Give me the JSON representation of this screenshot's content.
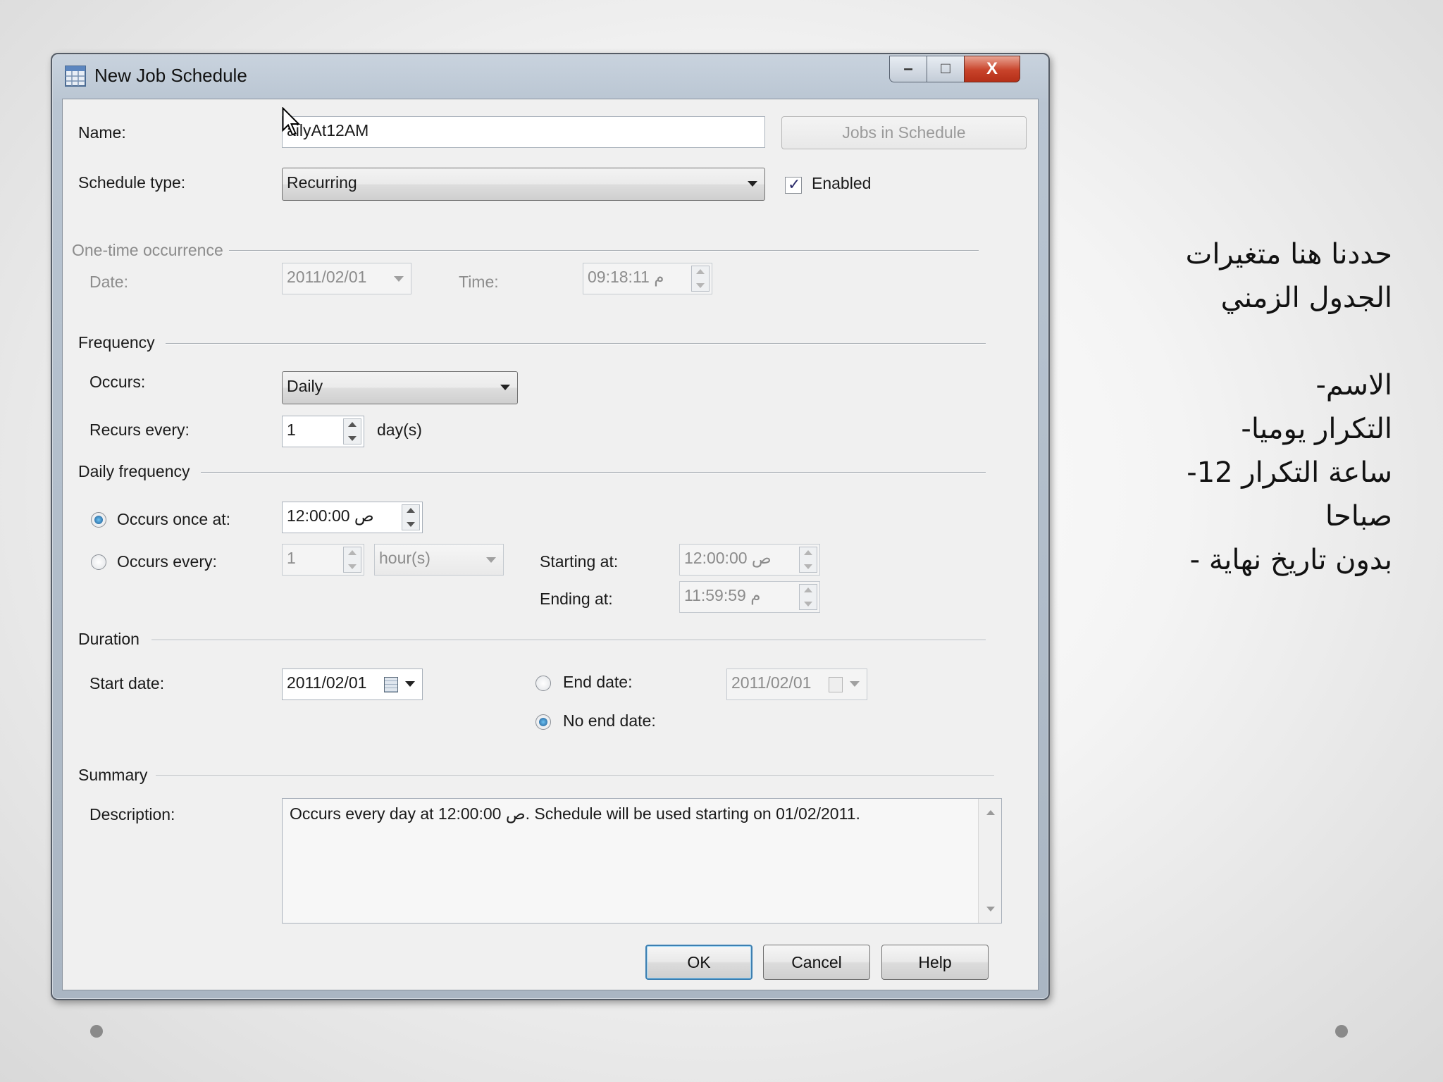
{
  "window": {
    "title": "New Job Schedule",
    "controls": {
      "minimize": "–",
      "maximize": "□",
      "close": "X"
    }
  },
  "form": {
    "name_label": "Name:",
    "name_value": "ailyAt12AM",
    "jobs_button": "Jobs in Schedule",
    "schedule_type_label": "Schedule type:",
    "schedule_type_value": "Recurring",
    "enabled_label": "Enabled",
    "enabled_checked": true
  },
  "one_time": {
    "section": "One-time occurrence",
    "date_label": "Date:",
    "date_value": "2011/02/01",
    "time_label": "Time:",
    "time_value": "09:18:11 م"
  },
  "frequency": {
    "section": "Frequency",
    "occurs_label": "Occurs:",
    "occurs_value": "Daily",
    "recurs_label": "Recurs every:",
    "recurs_value": "1",
    "recurs_unit": "day(s)"
  },
  "daily_frequency": {
    "section": "Daily frequency",
    "once_label": "Occurs once at:",
    "once_value": "12:00:00 ص",
    "once_selected": true,
    "every_label": "Occurs every:",
    "every_value": "1",
    "every_unit": "hour(s)",
    "starting_label": "Starting at:",
    "starting_value": "12:00:00 ص",
    "ending_label": "Ending at:",
    "ending_value": "11:59:59 م"
  },
  "duration": {
    "section": "Duration",
    "start_label": "Start date:",
    "start_value": "2011/02/01",
    "end_label": "End date:",
    "end_value": "2011/02/01",
    "no_end_label": "No end date:",
    "no_end_selected": true
  },
  "summary": {
    "section": "Summary",
    "description_label": "Description:",
    "description_value": "Occurs every day at 12:00:00 ص. Schedule will be used starting on 01/02/2011."
  },
  "buttons": {
    "ok": "OK",
    "cancel": "Cancel",
    "help": "Help"
  },
  "side_notes": [
    "حددنا هنا متغيرات",
    "الجدول الزمني",
    "",
    "الاسم-",
    "التكرار يوميا-",
    "ساعة التكرار 12-",
    "صباحا",
    "بدون تاريخ نهاية -"
  ],
  "colors": {
    "accent": "#3c7fb1",
    "close_button": "#c8432a",
    "dialog_bg": "#f0f0f0"
  }
}
